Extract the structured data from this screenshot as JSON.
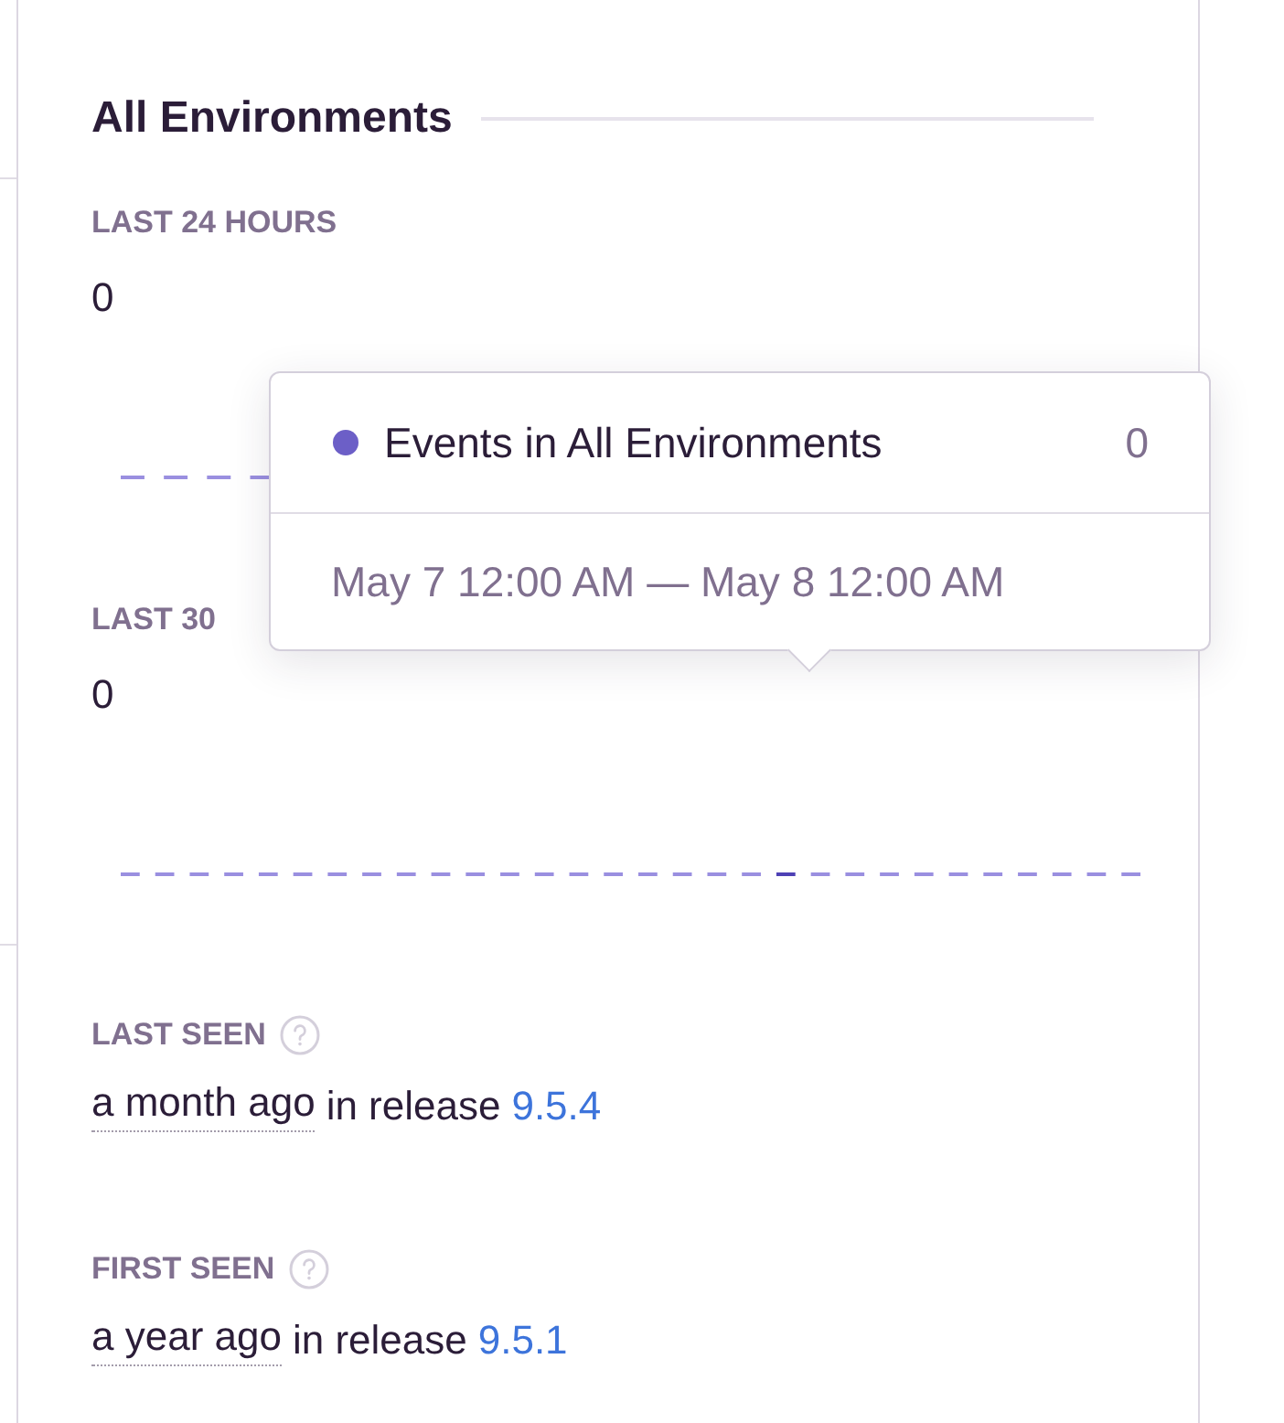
{
  "heading": "All Environments",
  "stats": [
    {
      "label": "LAST 24 HOURS",
      "count": "0"
    },
    {
      "label": "LAST 30",
      "count": "0"
    }
  ],
  "tooltip": {
    "series": "Events in All Environments",
    "value": "0",
    "range": "May 7 12:00 AM — May 8 12:00 AM"
  },
  "seen": [
    {
      "label": "LAST SEEN",
      "time": "a month ago",
      "text": "in release",
      "release": "9.5.4"
    },
    {
      "label": "FIRST SEEN",
      "time": "a year ago",
      "text": "in release",
      "release": "9.5.1"
    }
  ]
}
